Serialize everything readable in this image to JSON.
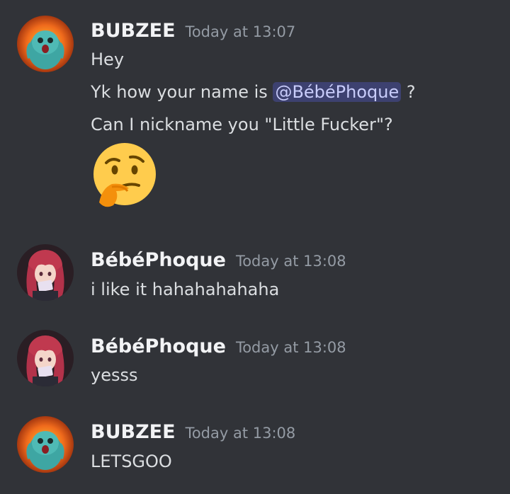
{
  "messages": [
    {
      "author": "BUBZEE",
      "timestamp": "Today at 13:07",
      "lines": {
        "l1": "Hey",
        "l2_prefix": "Yk how your name is ",
        "l2_mention": "@BébéPhoque",
        "l2_suffix": " ?",
        "l3": "Can I nickname you \"Little Fucker\"?"
      },
      "emoji": "thinking-face"
    },
    {
      "author": "BébéPhoque",
      "timestamp": "Today at 13:08",
      "text": "i like it hahahahahaha"
    },
    {
      "author": "BébéPhoque",
      "timestamp": "Today at 13:08",
      "text": "yesss"
    },
    {
      "author": "BUBZEE",
      "timestamp": "Today at 13:08",
      "text": "LETSGOO"
    }
  ],
  "colors": {
    "background": "#313338",
    "username": "#f2f3f5",
    "timestamp": "#949ba4",
    "text": "#dbdee1",
    "mention_bg": "rgba(88,101,242,0.3)",
    "mention_text": "#c9cdfb"
  }
}
